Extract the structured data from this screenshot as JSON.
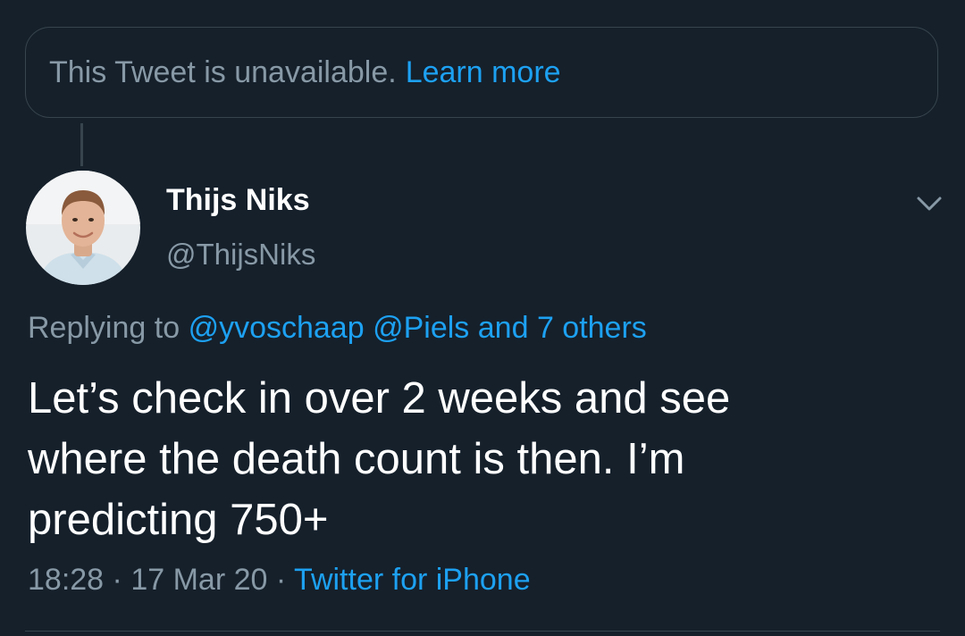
{
  "unavailable_notice": {
    "text": "This Tweet is unavailable.",
    "link_label": "Learn more"
  },
  "author": {
    "display_name": "Thijs Niks",
    "handle": "@ThijsNiks",
    "avatar_icon": "profile-photo"
  },
  "reply_context": {
    "prefix": "Replying to",
    "mention_1": "@yvoschaap",
    "mention_2": "@Piels",
    "connector": "and",
    "others": "7 others"
  },
  "tweet": {
    "line_1": "Let’s check in over 2 weeks and see",
    "line_2": "where the death count is then. I’m",
    "line_3": "predicting 750+"
  },
  "meta": {
    "time": "18:28",
    "separator": "·",
    "date": "17 Mar 20",
    "source": "Twitter for iPhone"
  },
  "colors": {
    "background": "#15202b",
    "accent": "#1da1f2",
    "secondary_text": "#8899a6",
    "border": "#38444d"
  }
}
